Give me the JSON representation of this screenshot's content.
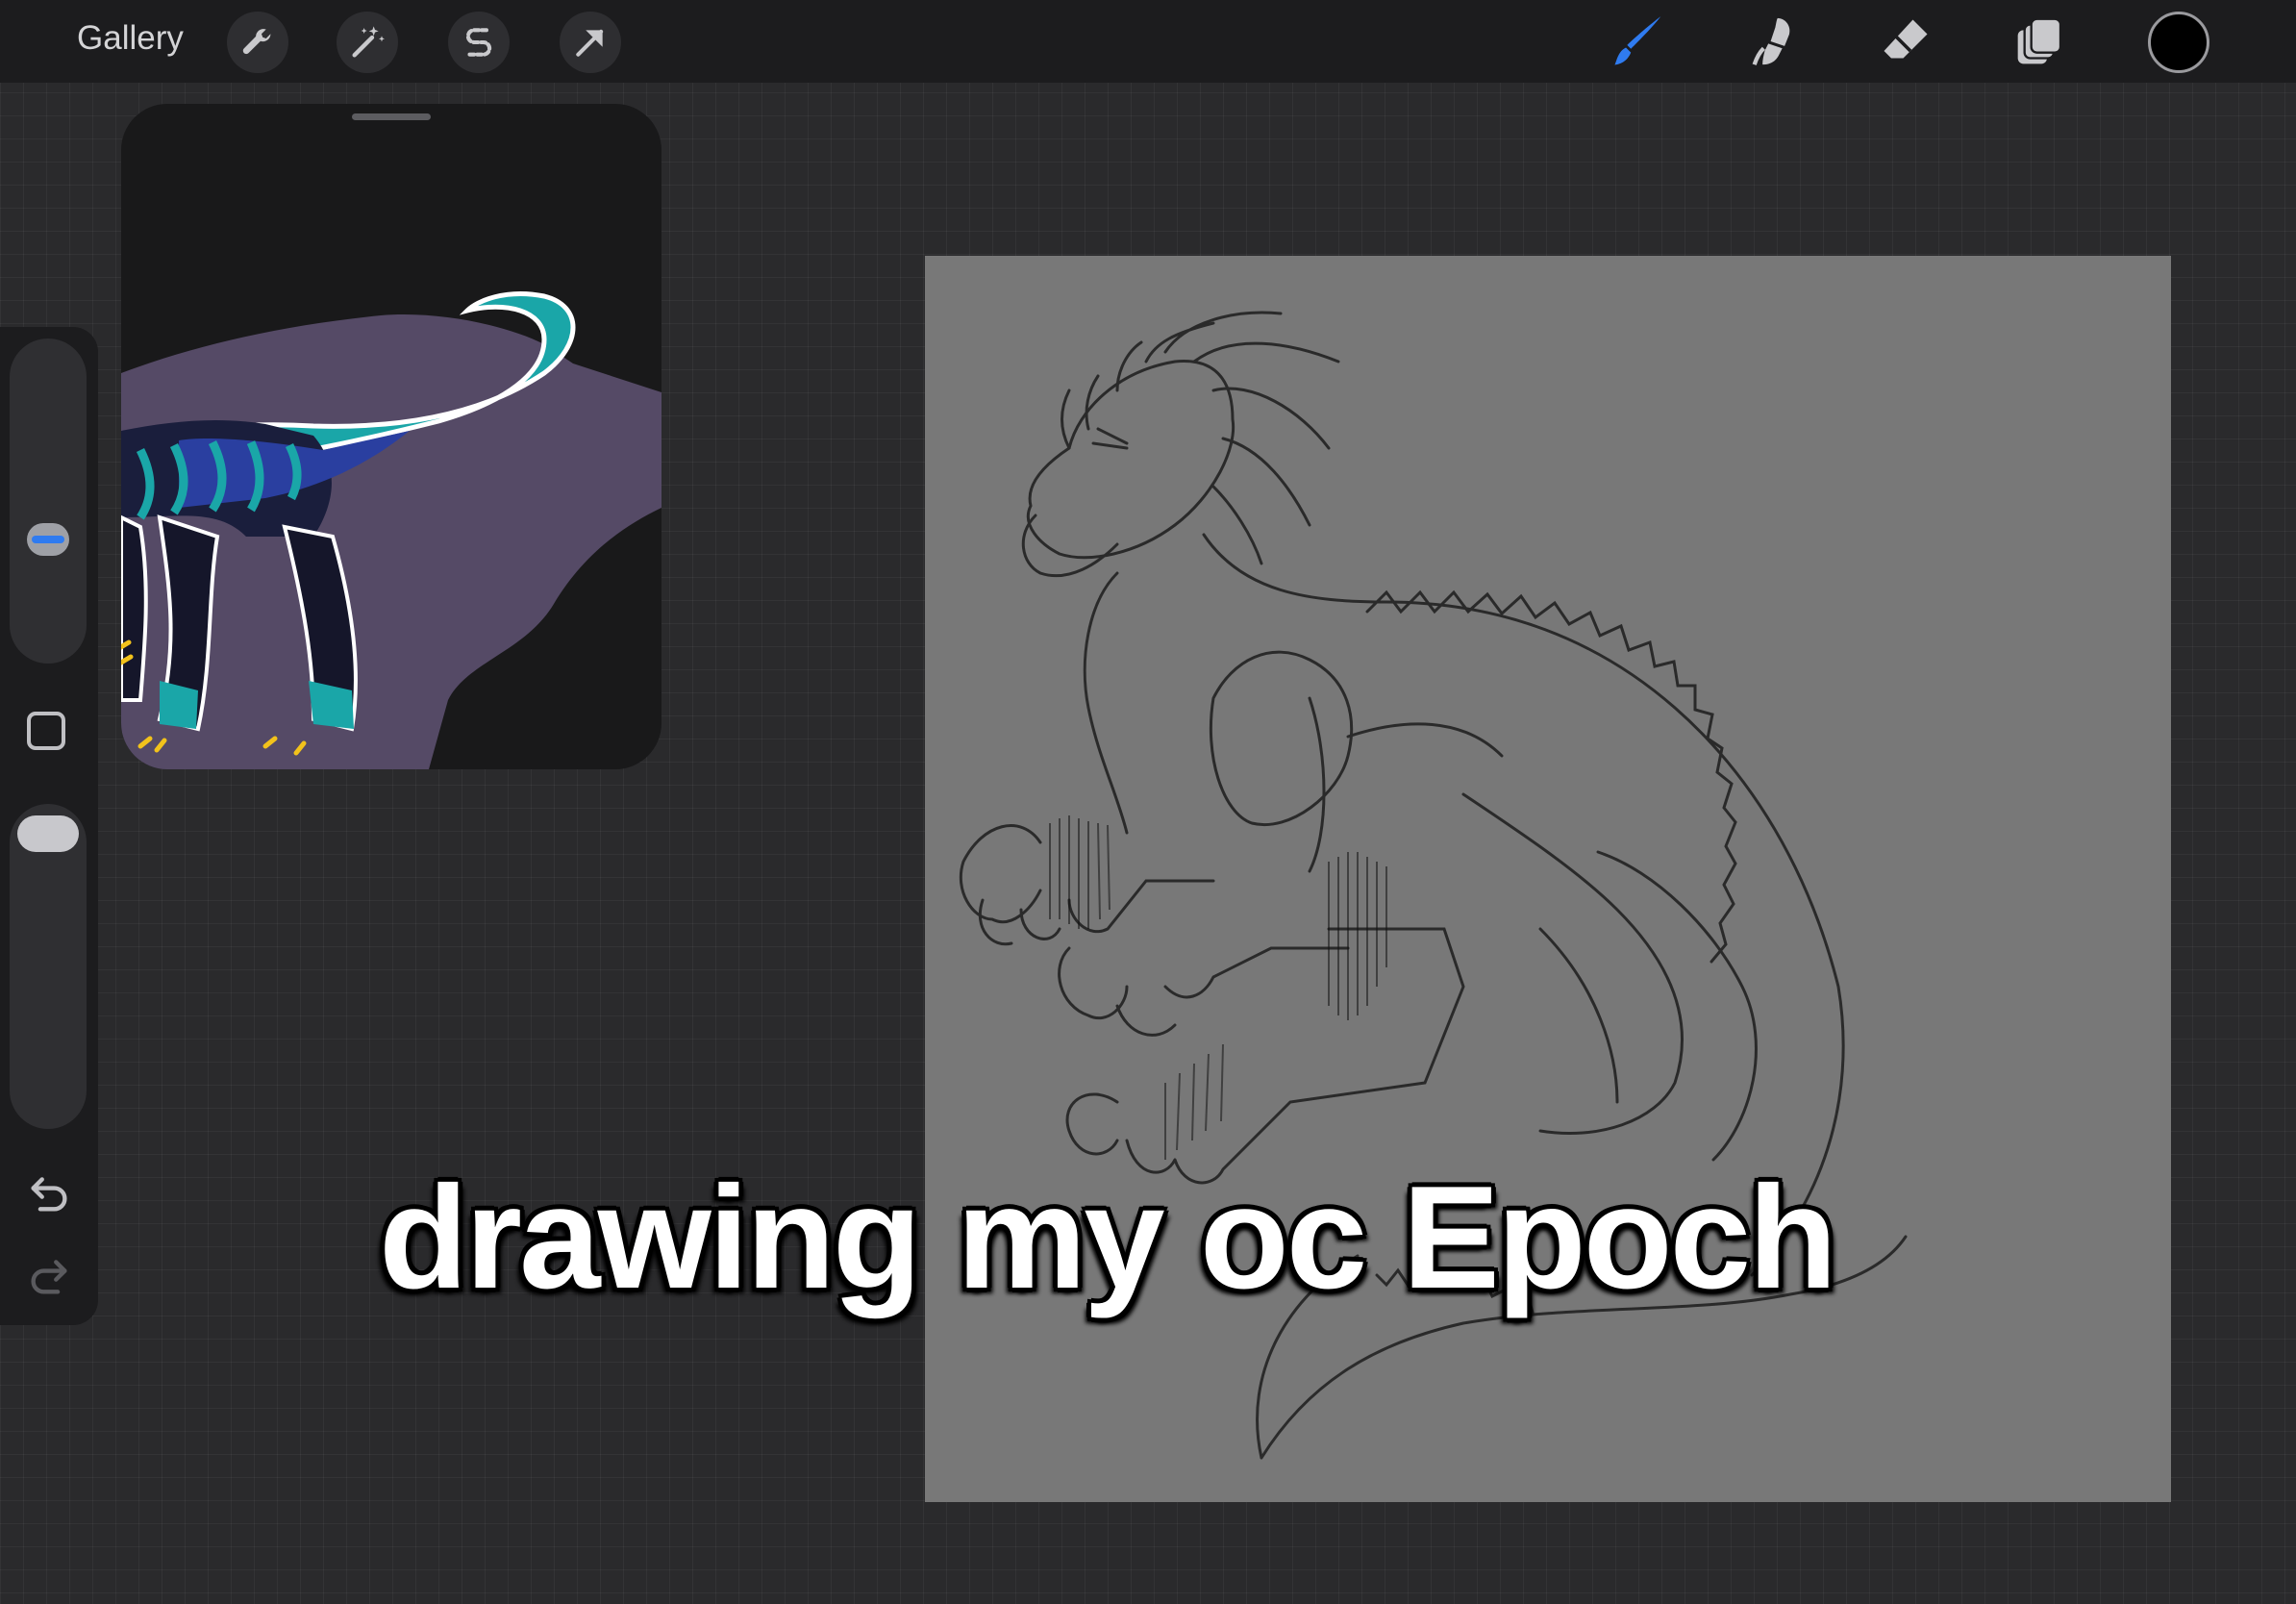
{
  "toolbar": {
    "gallery_label": "Gallery",
    "left_tools": [
      "wrench-icon",
      "magic-wand-icon",
      "selection-s-icon",
      "transform-arrow-icon"
    ],
    "right_tools": [
      "brush-icon",
      "smudge-icon",
      "eraser-icon",
      "layers-icon"
    ],
    "active_tool": "brush-icon",
    "active_color": "#000000",
    "accent_color": "#2f7bf0"
  },
  "sidebar": {
    "brush_size_level": 0.42,
    "opacity_level": 1.0,
    "controls": [
      "modify-square-icon",
      "undo-icon",
      "redo-icon"
    ]
  },
  "canvas": {
    "background_color": "#787878"
  },
  "caption": {
    "text": "drawing my oc Epoch"
  }
}
